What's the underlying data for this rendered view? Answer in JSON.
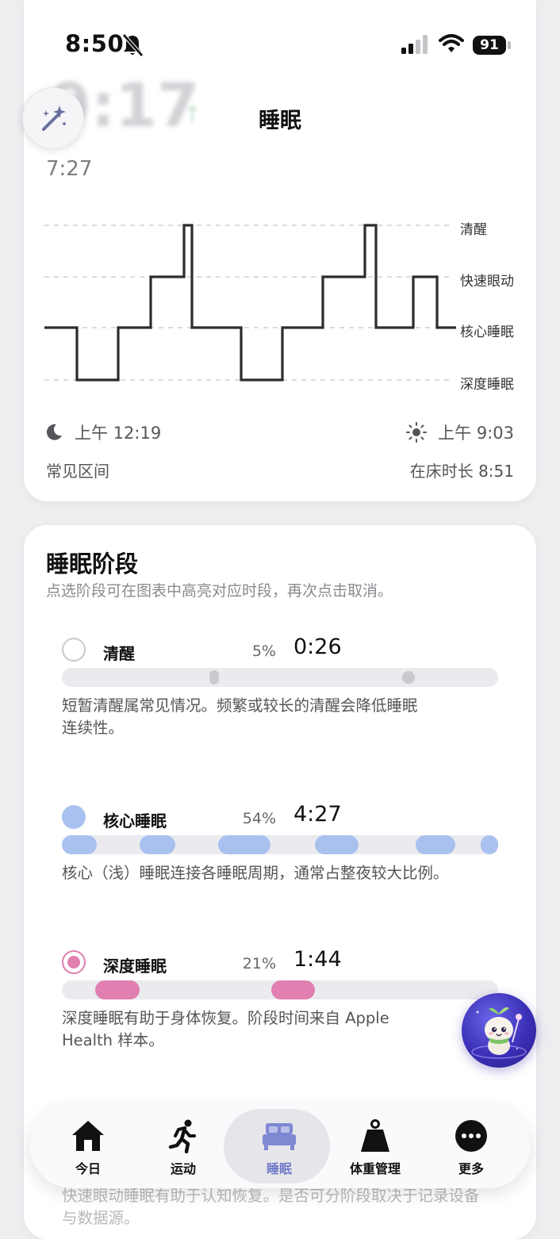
{
  "status_bar": {
    "time": "8:50",
    "battery": "91"
  },
  "background_peek": {
    "big_value": "9:17",
    "sub_value": "7:27"
  },
  "nav": {
    "title": "睡眠"
  },
  "hypnogram": {
    "stage_labels": [
      "清醒",
      "快速眼动",
      "核心睡眠",
      "深度睡眠"
    ],
    "line_color": "#2c2c30"
  },
  "sleep_window": {
    "start": "上午 12:19",
    "end": "上午 9:03"
  },
  "range_label": "常见区间",
  "in_bed": "在床时长 8:51",
  "stages_section": {
    "title": "睡眠阶段",
    "subtitle": "点选阶段可在图表中高亮对应时段，再次点击取消。",
    "stages": [
      {
        "name": "清醒",
        "percent": "5%",
        "duration": "0:26",
        "description": "短暂清醒属常见情况。频繁或较长的清醒会降低睡眠连续性。",
        "color": "#c9c9cf"
      },
      {
        "name": "核心睡眠",
        "percent": "54%",
        "duration": "4:27",
        "description": "核心（浅）睡眠连接各睡眠周期，通常占整夜较大比例。",
        "color": "#a9c1ee"
      },
      {
        "name": "深度睡眠",
        "percent": "21%",
        "duration": "1:44",
        "description": "深度睡眠有助于身体恢复。阶段时间来自 Apple Health 样本。",
        "color": "#e07fb0"
      }
    ]
  },
  "peek_text": "快速眼动睡眠有助于认知恢复。是否可分阶段取决于记录设备与数据源。",
  "tabbar": {
    "tabs": [
      {
        "label": "今日",
        "icon": "home-icon"
      },
      {
        "label": "运动",
        "icon": "running-icon"
      },
      {
        "label": "睡眠",
        "icon": "bed-icon",
        "active": true
      },
      {
        "label": "体重管理",
        "icon": "weight-icon"
      },
      {
        "label": "更多",
        "icon": "more-icon"
      }
    ],
    "active_color": "#6f78c9"
  }
}
